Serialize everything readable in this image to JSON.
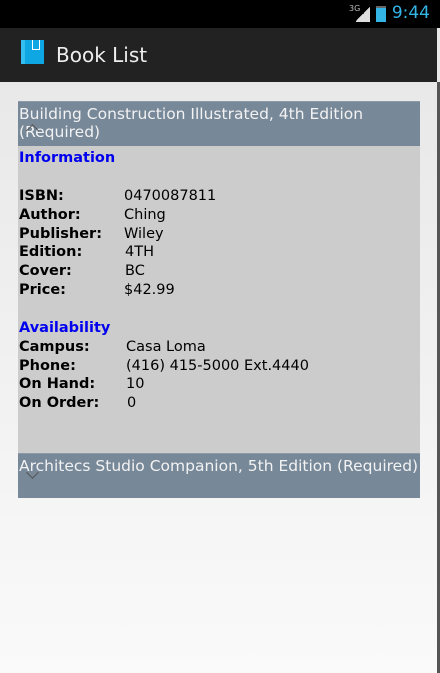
{
  "status": {
    "network": "3G",
    "time": "9:44"
  },
  "app": {
    "title": "Book List"
  },
  "books": [
    {
      "title": "Building Construction Illustrated, 4th Edition (Required)",
      "expanded": true,
      "info_heading": "Information",
      "info": [
        {
          "label": "ISBN:",
          "value": "0470087811"
        },
        {
          "label": "Author:",
          "value": "Ching"
        },
        {
          "label": "Publisher:",
          "value": "Wiley"
        },
        {
          "label": "Edition:",
          "value": "4TH"
        },
        {
          "label": "Cover:",
          "value": "BC"
        },
        {
          "label": "Price:",
          "value": "$42.99"
        }
      ],
      "avail_heading": "Availability",
      "avail": [
        {
          "label": "Campus:",
          "value": "Casa Loma"
        },
        {
          "label": "Phone:",
          "value": "(416) 415-5000 Ext.4440"
        },
        {
          "label": "On Hand:",
          "value": "10"
        },
        {
          "label": "On Order:",
          "value": "0"
        }
      ]
    },
    {
      "title": "Architecs Studio Companion, 5th Edition (Required)",
      "expanded": false
    }
  ]
}
